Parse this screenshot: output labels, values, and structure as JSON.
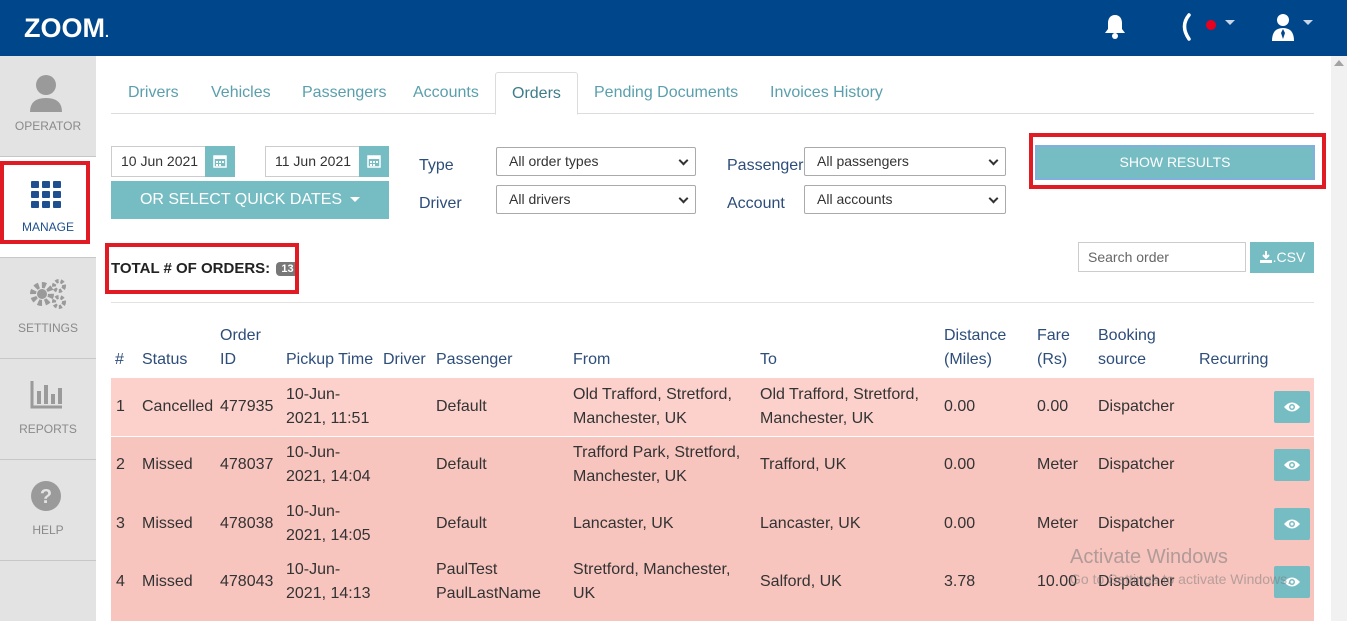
{
  "app": {
    "logo": "ZOOM",
    "logo_dot": "."
  },
  "sidebar": {
    "items": [
      {
        "label": "OPERATOR",
        "icon": "person-icon"
      },
      {
        "label": "MANAGE",
        "icon": "grid-icon"
      },
      {
        "label": "SETTINGS",
        "icon": "gears-icon"
      },
      {
        "label": "REPORTS",
        "icon": "bar-chart-icon"
      },
      {
        "label": "HELP",
        "icon": "help-icon"
      }
    ]
  },
  "tabs": [
    {
      "label": "Drivers"
    },
    {
      "label": "Vehicles"
    },
    {
      "label": "Passengers"
    },
    {
      "label": "Accounts"
    },
    {
      "label": "Orders",
      "active": true
    },
    {
      "label": "Pending Documents"
    },
    {
      "label": "Invoices History"
    }
  ],
  "filters": {
    "date_from": "10 Jun 2021",
    "date_to": "11 Jun 2021",
    "quick_dates_label": "OR SELECT QUICK DATES",
    "type_label": "Type",
    "type_value": "All order types",
    "driver_label": "Driver",
    "driver_value": "All drivers",
    "passenger_label": "Passenger",
    "passenger_value": "All passengers",
    "account_label": "Account",
    "account_value": "All accounts",
    "show_results_label": "SHOW RESULTS"
  },
  "summary": {
    "total_label": "TOTAL # OF ORDERS:",
    "total_count": "13"
  },
  "search": {
    "placeholder": "Search order"
  },
  "csv_label": ".CSV",
  "table": {
    "headers": {
      "num": "#",
      "status": "Status",
      "order_id_1": "Order",
      "order_id_2": "ID",
      "pickup": "Pickup Time",
      "driver": "Driver",
      "passenger": "Passenger",
      "from": "From",
      "to": "To",
      "distance_1": "Distance",
      "distance_2": "(Miles)",
      "fare_1": "Fare",
      "fare_2": "(Rs)",
      "booking_1": "Booking",
      "booking_2": "source",
      "recurring": "Recurring"
    },
    "rows": [
      {
        "num": "1",
        "status": "Cancelled",
        "order_id": "477935",
        "pickup_1": "10-Jun-",
        "pickup_2": "2021, 11:51",
        "driver": "",
        "passenger_1": "Default",
        "passenger_2": "",
        "from_1": "Old Trafford, Stretford,",
        "from_2": "Manchester, UK",
        "to_1": "Old Trafford, Stretford,",
        "to_2": "Manchester, UK",
        "distance": "0.00",
        "fare": "0.00",
        "booking": "Dispatcher",
        "recurring": ""
      },
      {
        "num": "2",
        "status": "Missed",
        "order_id": "478037",
        "pickup_1": "10-Jun-",
        "pickup_2": "2021, 14:04",
        "driver": "",
        "passenger_1": "Default",
        "passenger_2": "",
        "from_1": "Trafford Park, Stretford,",
        "from_2": "Manchester, UK",
        "to_1": "Trafford, UK",
        "to_2": "",
        "distance": "0.00",
        "fare": "Meter",
        "booking": "Dispatcher",
        "recurring": ""
      },
      {
        "num": "3",
        "status": "Missed",
        "order_id": "478038",
        "pickup_1": "10-Jun-",
        "pickup_2": "2021, 14:05",
        "driver": "",
        "passenger_1": "Default",
        "passenger_2": "",
        "from_1": "Lancaster, UK",
        "from_2": "",
        "to_1": "Lancaster, UK",
        "to_2": "",
        "distance": "0.00",
        "fare": "Meter",
        "booking": "Dispatcher",
        "recurring": ""
      },
      {
        "num": "4",
        "status": "Missed",
        "order_id": "478043",
        "pickup_1": "10-Jun-",
        "pickup_2": "2021, 14:13",
        "driver": "",
        "passenger_1": "PaulTest",
        "passenger_2": "PaulLastName",
        "from_1": "Stretford, Manchester,",
        "from_2": "UK",
        "to_1": "Salford, UK",
        "to_2": "",
        "distance": "3.78",
        "fare": "10.00",
        "booking": "Dispatcher",
        "recurring": ""
      }
    ]
  },
  "watermark": {
    "title": "Activate Windows",
    "subtitle": "Go to Settings to activate Windows."
  }
}
